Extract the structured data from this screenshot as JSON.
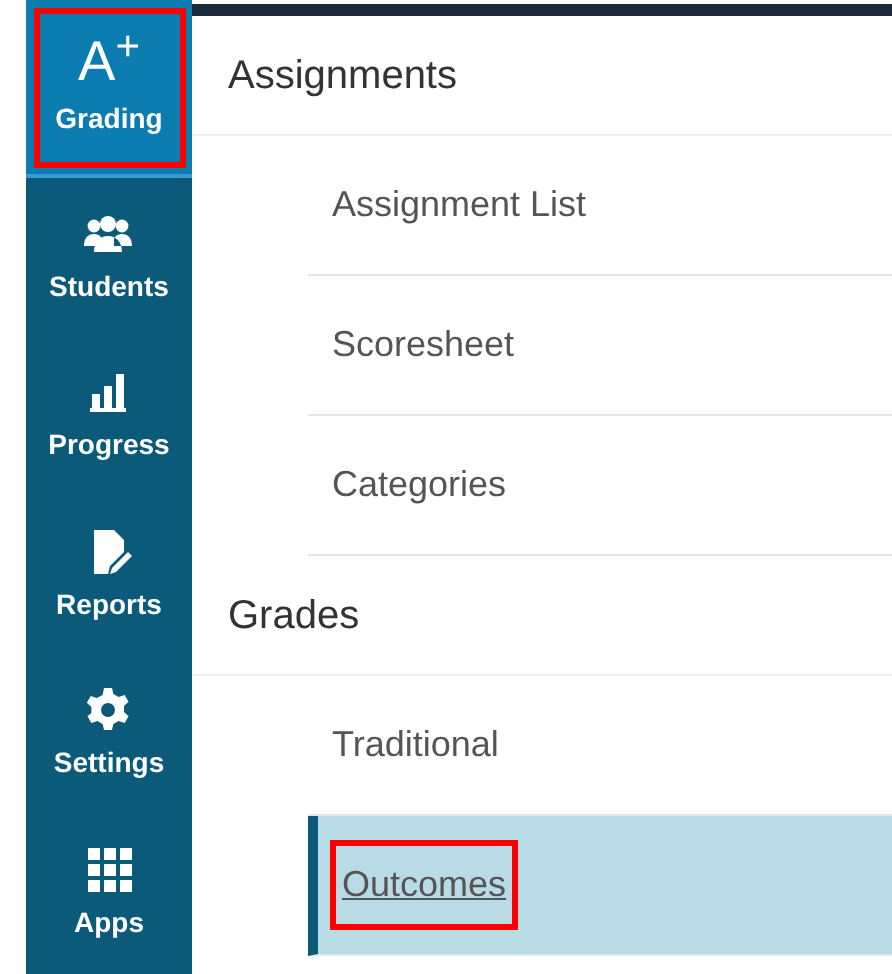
{
  "sidebar": {
    "items": [
      {
        "label": "Grading",
        "glyph": "A$^{+}$",
        "selected": true,
        "highlighted": true
      },
      {
        "label": "Students",
        "selected": false,
        "highlighted": false
      },
      {
        "label": "Progress",
        "selected": false,
        "highlighted": false
      },
      {
        "label": "Reports",
        "selected": false,
        "highlighted": false
      },
      {
        "label": "Settings",
        "selected": false,
        "highlighted": false
      },
      {
        "label": "Apps",
        "selected": false,
        "highlighted": false
      }
    ]
  },
  "sections": [
    {
      "title": "Assignments",
      "items": [
        {
          "label": "Assignment List",
          "selected": false,
          "highlighted": false
        },
        {
          "label": "Scoresheet",
          "selected": false,
          "highlighted": false
        },
        {
          "label": "Categories",
          "selected": false,
          "highlighted": false
        }
      ]
    },
    {
      "title": "Grades",
      "items": [
        {
          "label": "Traditional",
          "selected": false,
          "highlighted": false
        },
        {
          "label": "Outcomes",
          "selected": true,
          "highlighted": true
        }
      ]
    }
  ]
}
